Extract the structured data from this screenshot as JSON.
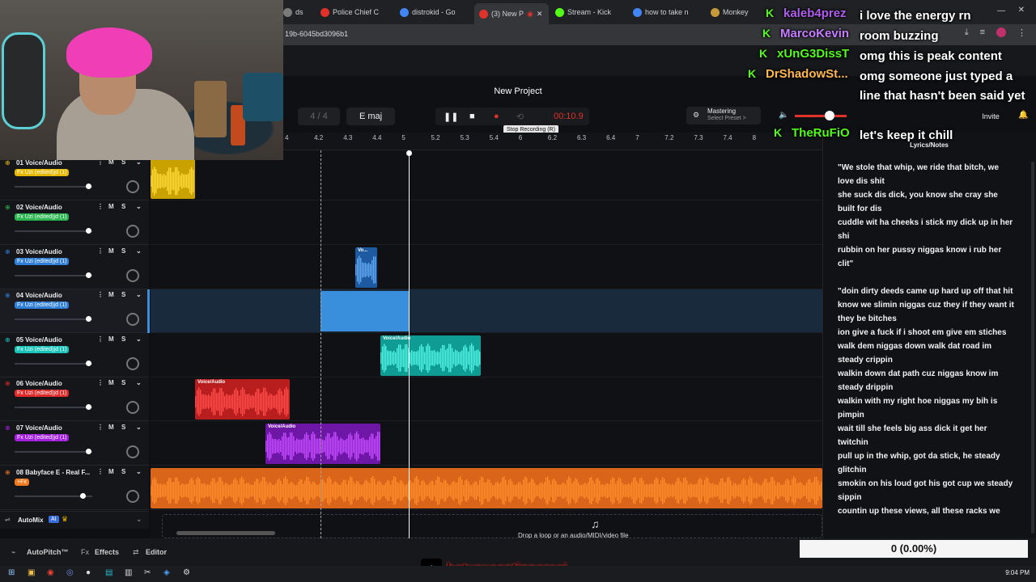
{
  "browser": {
    "tabs": [
      {
        "label": "ds",
        "color": "#7a7a7a"
      },
      {
        "label": "Police Chief C",
        "color": "#e0312b"
      },
      {
        "label": "distrokid - Go",
        "color": "#4285f4"
      },
      {
        "label": "(3) New P",
        "color": "#e0312b"
      },
      {
        "label": "Stream - Kick",
        "color": "#53fc18"
      },
      {
        "label": "how to take n",
        "color": "#4285f4"
      },
      {
        "label": "Monkey",
        "color": "#c49a3a"
      }
    ],
    "url": "19b-6045bd3096b1"
  },
  "daw": {
    "project_title": "New Project",
    "time_sig": "4 / 4",
    "key": "E maj",
    "time": "00:10.9",
    "tooltip": "Stop Recording (R)",
    "mastering_label": "Mastering",
    "mastering_sub": "Select Preset >",
    "invite_label": "Invite",
    "ruler": [
      "4",
      "4.2",
      "4.3",
      "4.4",
      "5",
      "5.2",
      "5.3",
      "5.4",
      "6",
      "6.2",
      "6.3",
      "6.4",
      "7",
      "7.2",
      "7.3",
      "7.4",
      "8"
    ],
    "tracks": [
      {
        "name": "01 Voice/Audio",
        "fx": "Fx Uzi (edited)jd (1)",
        "color": "#e6b800",
        "knob": 0.95
      },
      {
        "name": "02 Voice/Audio",
        "fx": "Fx Uzi (edited)jd (1)",
        "color": "#2bb550",
        "knob": 0.95
      },
      {
        "name": "03 Voice/Audio",
        "fx": "Fx Uzi (edited)jd (1)",
        "color": "#2f7fd8",
        "knob": 0.95
      },
      {
        "name": "04 Voice/Audio",
        "fx": "Fx Uzi (edited)jd (1)",
        "color": "#2f7fd8",
        "knob": 0.95
      },
      {
        "name": "05 Voice/Audio",
        "fx": "Fx Uzi (edited)jd (1)",
        "color": "#18c4b8",
        "knob": 0.95
      },
      {
        "name": "06 Voice/Audio",
        "fx": "Fx Uzi (edited)jd (1)",
        "color": "#e02a2a",
        "knob": 0.95
      },
      {
        "name": "07 Voice/Audio",
        "fx": "Fx Uzi (edited)jd (1)",
        "color": "#a21fe0",
        "knob": 0.95
      },
      {
        "name": "08 Babyface E - Real F...",
        "fx": "+Fx",
        "color": "#f07b1e",
        "knob": 0.88
      }
    ],
    "clip_label": "Voice/Audio",
    "clip_label_short": "Vo...",
    "automix_label": "AutoMix",
    "automix_badge": "AI",
    "drop_hint": "Drop a loop or an audio/MIDI/video file",
    "bottom_tabs": [
      "AutoPitch™",
      "Effects",
      "Editor"
    ],
    "lyrics_title": "Lyrics/Notes",
    "lyrics": [
      "\"We stole that whip, we ride that bitch, we love dis shit",
      "she suck dis dick, you know she cray she built for dis",
      "cuddle wit ha cheeks i stick my dick up in her shi",
      "rubbin on her pussy niggas know i rub her clit\"",
      "",
      "\"doin dirty deeds came up hard up off that hit",
      "know we slimin niggas cuz they if they want it they be bitches",
      "ion give a fuck if i shoot em give em stiches",
      "walk dem niggas down walk dat road im steady crippin",
      "walkin down dat path cuz niggas know im steady drippin",
      "walkin with my right hoe niggas my bih is pimpin",
      "wait till she feels big ass dick it get her twitchin",
      "pull up in the whip, got da stick, he steady glitchin",
      "smokin on his loud got his got cup we steady sippin",
      "countin up these views, all these racks we"
    ]
  },
  "chat": [
    {
      "user": "kaleb4prez",
      "color": "#b05df0",
      "msg": "i love the energy rn"
    },
    {
      "user": "MarcoKevin",
      "color": "#c77dff",
      "msg": "room buzzing"
    },
    {
      "user": "xUnG3DissT",
      "color": "#53fc18",
      "msg": "omg this is peak content"
    },
    {
      "user": "DrShadowSt...",
      "color": "#ffb84d",
      "msg": "omg someone just typed a line that hasn't been said yet"
    },
    {
      "user": "TheRuFiO",
      "color": "#53fc18",
      "msg": "let's keep it chill"
    }
  ],
  "stream": {
    "counter": "0 (0.00%)",
    "tiktok_handle": "botyoucantignoreej",
    "clock": "9:04 PM"
  },
  "colors": {
    "accent_red": "#e0312b",
    "playhead": "#ffffff",
    "selection": "#3a8fdc"
  }
}
